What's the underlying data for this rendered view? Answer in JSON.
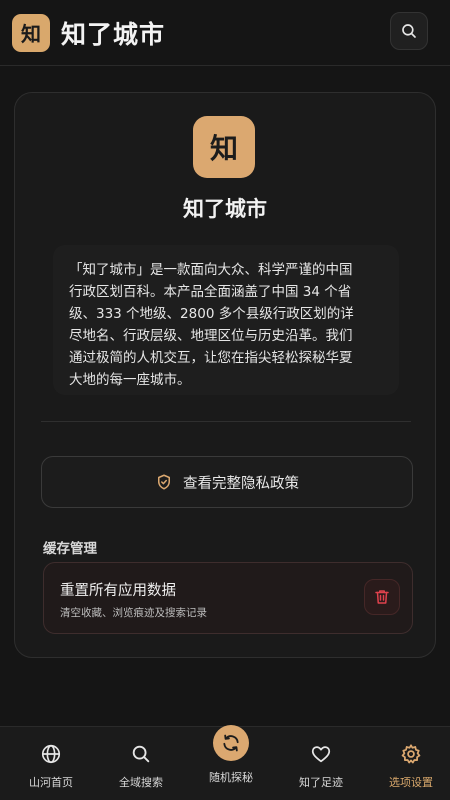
{
  "header": {
    "logo_char": "知",
    "title": "知了城市",
    "search_icon": "search-icon"
  },
  "about": {
    "logo_char": "知",
    "title": "知了城市",
    "description_lines": [
      "「知了城市」是一款面向大众、科学严谨的中国",
      "行政区划百科。本产品全面涵盖了中国 34 个省",
      "级、333 个地级、2800 多个县级行政区划的详",
      "尽地名、行政层级、地理区位与历史沿革。我们",
      "通过极简的人机交互，让您在指尖轻松探秘华夏",
      "大地的每一座城市。"
    ],
    "privacy_label": "查看完整隐私政策"
  },
  "cache": {
    "section_label": "缓存管理",
    "reset_title": "重置所有应用数据",
    "reset_subtitle": "清空收藏、浏览痕迹及搜索记录"
  },
  "nav": {
    "items": [
      {
        "label": "山河首页",
        "icon": "globe-icon"
      },
      {
        "label": "全域搜索",
        "icon": "search-icon"
      },
      {
        "label": "随机探秘",
        "icon": "refresh-icon"
      },
      {
        "label": "知了足迹",
        "icon": "heart-icon"
      },
      {
        "label": "选项设置",
        "icon": "gear-icon"
      }
    ],
    "active_index": 4
  },
  "colors": {
    "accent": "#dba870",
    "background": "#151515",
    "danger": "#e0424d"
  }
}
